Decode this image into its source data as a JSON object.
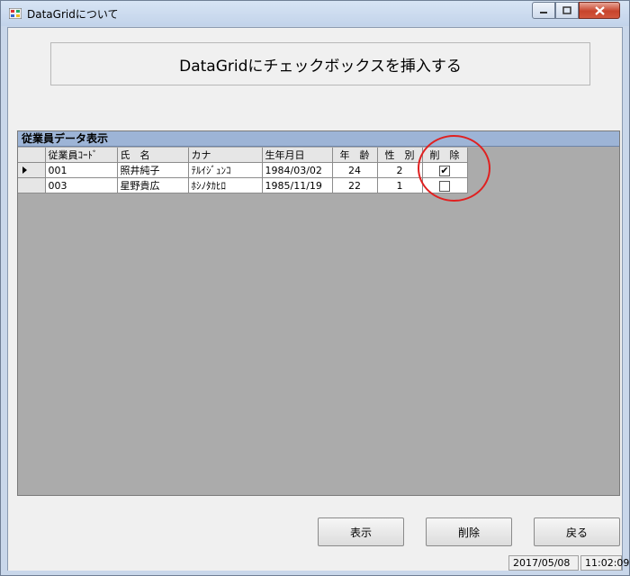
{
  "window": {
    "title": "DataGridについて"
  },
  "header": {
    "text": "DataGridにチェックボックスを挿入する"
  },
  "grid": {
    "caption": "従業員データ表示",
    "columns": [
      "従業員ｺｰﾄﾞ",
      "氏　名",
      "カナ",
      "生年月日",
      "年　齢",
      "性　別",
      "削　除"
    ],
    "rows": [
      {
        "code": "001",
        "name": "照井純子",
        "kana": "ﾃﾙｲｼﾞｭﾝｺ",
        "birth": "1984/03/02",
        "age": "24",
        "sex": "2",
        "deleted": true
      },
      {
        "code": "003",
        "name": "星野貴広",
        "kana": "ﾎｼﾉﾀｶﾋﾛ",
        "birth": "1985/11/19",
        "age": "22",
        "sex": "1",
        "deleted": false
      }
    ]
  },
  "buttons": {
    "show": "表示",
    "delete": "削除",
    "back": "戻る"
  },
  "status": {
    "date": "2017/05/08",
    "time": "11:02:09"
  },
  "colors": {
    "caption_bg": "#9db4d6",
    "grid_bg": "#ababab",
    "highlight_circle": "#e02020"
  }
}
